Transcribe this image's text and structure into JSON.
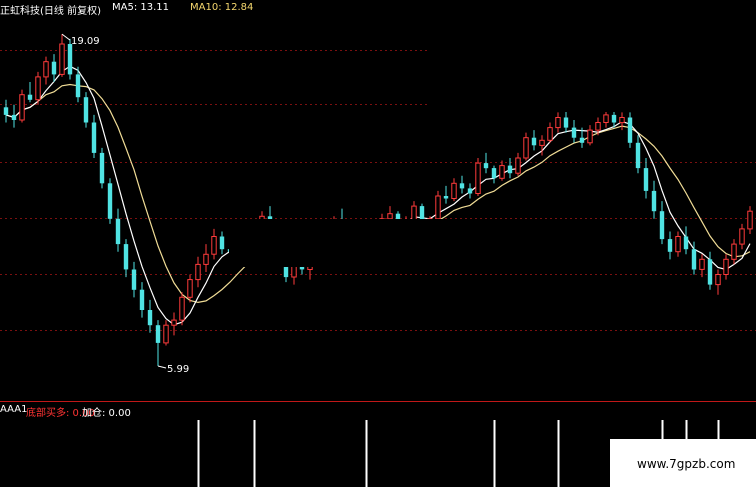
{
  "header": {
    "title": "正虹科技(日线 前复权)",
    "ma5_label": "MA5: 13.11",
    "ma10_label": "MA10: 12.84",
    "colors": {
      "title": "#ffffff",
      "ma5": "#ffffff",
      "ma10": "#f5d76e"
    }
  },
  "sub_header": {
    "name": "AAA1",
    "buy_label": "底部买多: 0.00",
    "add_label": "加仓: 0.00",
    "colors": {
      "name": "#ffffff",
      "buy": "#ff3333",
      "add": "#ffffff"
    }
  },
  "watermark": {
    "text": "www.7gpzb.com"
  },
  "colors": {
    "up": "#ff3b3b",
    "down": "#50e3e3",
    "ma5": "#ffffff",
    "ma10": "#f0dc96",
    "grid": "#7a1010",
    "signal": "#ffffff"
  },
  "chart_data": {
    "type": "candlestick",
    "title": "正虹科技(日线 前复权)",
    "ylim": [
      5.2,
      20.2
    ],
    "annotations": [
      {
        "text": "19.09",
        "value": 19.09,
        "kind": "high"
      },
      {
        "text": "5.99",
        "value": 5.99,
        "kind": "low"
      }
    ],
    "candles": [
      [
        16.2,
        16.5,
        15.6,
        15.9
      ],
      [
        15.9,
        16.3,
        15.4,
        15.7
      ],
      [
        15.7,
        16.9,
        15.6,
        16.7
      ],
      [
        16.7,
        17.2,
        16.4,
        16.5
      ],
      [
        16.5,
        17.6,
        16.3,
        17.4
      ],
      [
        17.4,
        18.2,
        17.1,
        18.0
      ],
      [
        18.0,
        18.3,
        17.2,
        17.5
      ],
      [
        17.5,
        19.09,
        17.4,
        18.7
      ],
      [
        18.7,
        18.9,
        17.3,
        17.5
      ],
      [
        17.5,
        17.8,
        16.4,
        16.6
      ],
      [
        16.6,
        16.8,
        15.4,
        15.6
      ],
      [
        15.6,
        15.9,
        14.2,
        14.4
      ],
      [
        14.4,
        14.6,
        13.0,
        13.2
      ],
      [
        13.2,
        13.4,
        11.6,
        11.8
      ],
      [
        11.8,
        12.2,
        10.5,
        10.8
      ],
      [
        10.8,
        11.0,
        9.5,
        9.8
      ],
      [
        9.8,
        10.1,
        8.7,
        9.0
      ],
      [
        9.0,
        9.3,
        7.9,
        8.2
      ],
      [
        8.2,
        8.6,
        7.3,
        7.6
      ],
      [
        7.6,
        7.8,
        5.99,
        6.9
      ],
      [
        6.9,
        7.8,
        6.8,
        7.6
      ],
      [
        7.6,
        8.1,
        7.2,
        7.8
      ],
      [
        7.8,
        8.9,
        7.6,
        8.7
      ],
      [
        8.7,
        9.6,
        8.5,
        9.4
      ],
      [
        9.4,
        10.3,
        9.1,
        10.0
      ],
      [
        10.0,
        10.8,
        9.7,
        10.4
      ],
      [
        10.4,
        11.4,
        10.2,
        11.1
      ],
      [
        11.1,
        11.3,
        10.4,
        10.6
      ],
      [
        10.6,
        11.0,
        10.1,
        10.5
      ],
      [
        10.5,
        10.8,
        10.0,
        10.3
      ],
      [
        10.3,
        11.0,
        10.2,
        10.8
      ],
      [
        10.8,
        11.3,
        10.5,
        10.9
      ],
      [
        10.9,
        12.1,
        10.8,
        11.9
      ],
      [
        11.9,
        12.3,
        11.2,
        11.4
      ],
      [
        11.4,
        11.7,
        10.4,
        10.6
      ],
      [
        10.6,
        10.8,
        9.3,
        9.5
      ],
      [
        9.5,
        10.4,
        9.2,
        10.2
      ],
      [
        10.2,
        10.6,
        9.6,
        9.8
      ],
      [
        9.8,
        10.3,
        9.4,
        10.1
      ],
      [
        10.1,
        11.2,
        10.0,
        11.0
      ],
      [
        11.0,
        11.4,
        10.5,
        10.7
      ],
      [
        10.7,
        11.9,
        10.6,
        11.7
      ],
      [
        11.7,
        12.2,
        11.0,
        11.2
      ],
      [
        11.2,
        11.5,
        10.4,
        10.6
      ],
      [
        10.6,
        11.1,
        10.2,
        10.9
      ],
      [
        10.9,
        11.3,
        10.5,
        10.7
      ],
      [
        10.7,
        11.2,
        10.5,
        11.0
      ],
      [
        11.0,
        12.0,
        10.9,
        11.8
      ],
      [
        11.8,
        12.3,
        11.5,
        12.0
      ],
      [
        12.0,
        12.1,
        11.4,
        11.6
      ],
      [
        11.6,
        11.9,
        11.3,
        11.7
      ],
      [
        11.7,
        12.5,
        11.6,
        12.3
      ],
      [
        12.3,
        12.4,
        11.4,
        11.6
      ],
      [
        11.6,
        11.9,
        11.3,
        11.8
      ],
      [
        11.8,
        12.9,
        11.7,
        12.7
      ],
      [
        12.7,
        13.1,
        12.4,
        12.6
      ],
      [
        12.6,
        13.4,
        12.5,
        13.2
      ],
      [
        13.2,
        13.5,
        12.8,
        13.0
      ],
      [
        13.0,
        13.2,
        12.6,
        12.8
      ],
      [
        12.8,
        14.2,
        12.7,
        14.0
      ],
      [
        14.0,
        14.4,
        13.6,
        13.8
      ],
      [
        13.8,
        13.9,
        13.2,
        13.4
      ],
      [
        13.4,
        14.1,
        13.3,
        13.9
      ],
      [
        13.9,
        14.2,
        13.4,
        13.6
      ],
      [
        13.6,
        14.4,
        13.5,
        14.2
      ],
      [
        14.2,
        15.2,
        14.1,
        15.0
      ],
      [
        15.0,
        15.3,
        14.5,
        14.7
      ],
      [
        14.7,
        15.1,
        14.3,
        14.9
      ],
      [
        14.9,
        15.6,
        14.8,
        15.4
      ],
      [
        15.4,
        16.0,
        15.2,
        15.8
      ],
      [
        15.8,
        16.2,
        15.2,
        15.4
      ],
      [
        15.4,
        15.7,
        14.8,
        15.0
      ],
      [
        15.0,
        15.4,
        14.6,
        14.8
      ],
      [
        14.8,
        15.5,
        14.7,
        15.3
      ],
      [
        15.3,
        15.8,
        15.1,
        15.6
      ],
      [
        15.6,
        16.1,
        15.4,
        15.9
      ],
      [
        15.9,
        16.3,
        15.4,
        15.6
      ],
      [
        15.6,
        16.0,
        15.3,
        15.8
      ],
      [
        15.8,
        16.0,
        14.6,
        14.8
      ],
      [
        14.8,
        15.1,
        13.6,
        13.8
      ],
      [
        13.8,
        14.2,
        12.6,
        12.9
      ],
      [
        12.9,
        13.3,
        11.8,
        12.1
      ],
      [
        12.1,
        12.5,
        10.8,
        11.0
      ],
      [
        11.0,
        11.3,
        10.2,
        10.5
      ],
      [
        10.5,
        11.3,
        10.3,
        11.1
      ],
      [
        11.1,
        11.5,
        10.4,
        10.6
      ],
      [
        10.6,
        10.9,
        9.6,
        9.8
      ],
      [
        9.8,
        10.4,
        9.5,
        10.2
      ],
      [
        10.2,
        10.5,
        9.0,
        9.2
      ],
      [
        9.2,
        9.8,
        8.8,
        9.6
      ],
      [
        9.6,
        10.4,
        9.4,
        10.2
      ],
      [
        10.2,
        11.0,
        10.0,
        10.8
      ],
      [
        10.8,
        11.6,
        10.6,
        11.4
      ],
      [
        11.4,
        12.3,
        11.2,
        12.1
      ]
    ],
    "signals_index": [
      24,
      31,
      45,
      61,
      69,
      82,
      85,
      89,
      94
    ]
  }
}
